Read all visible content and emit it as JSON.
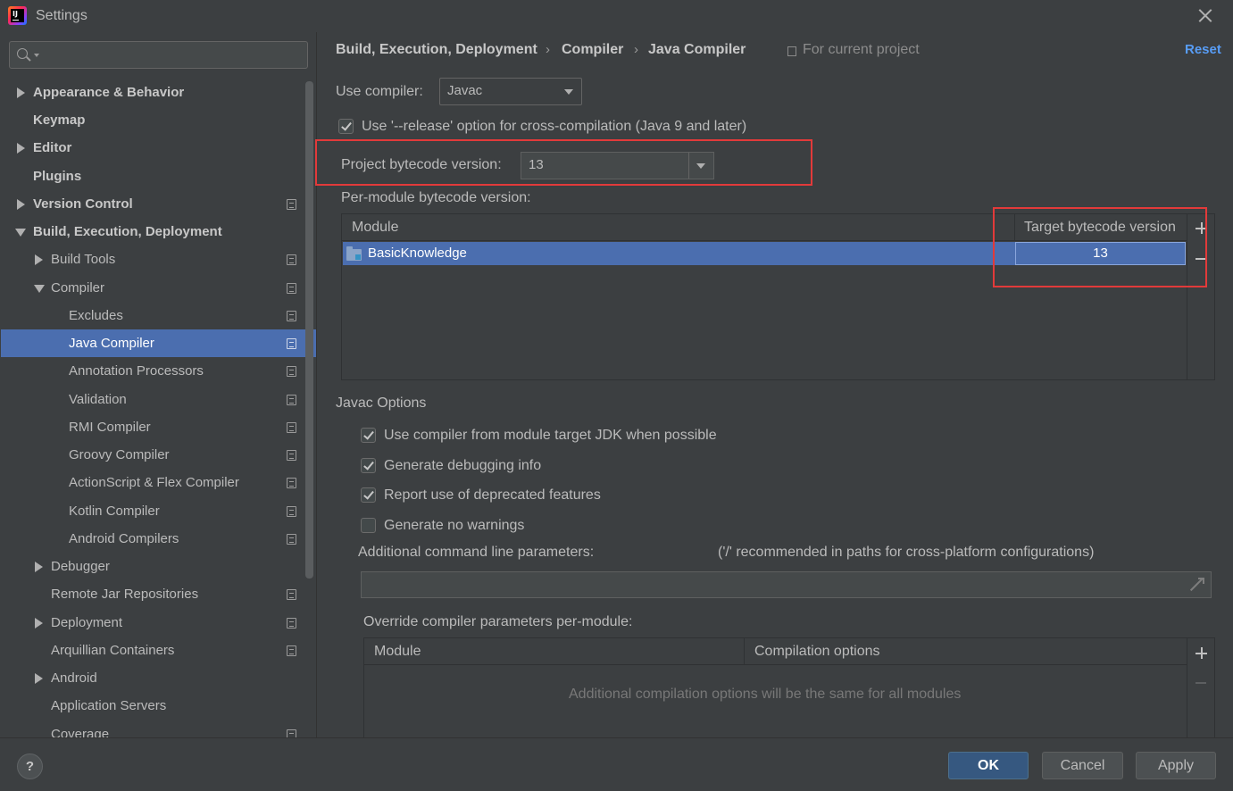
{
  "window": {
    "title": "Settings"
  },
  "search": {
    "placeholder": ""
  },
  "sidebar": {
    "items": [
      {
        "label": "Appearance & Behavior"
      },
      {
        "label": "Keymap"
      },
      {
        "label": "Editor"
      },
      {
        "label": "Plugins"
      },
      {
        "label": "Version Control"
      },
      {
        "label": "Build, Execution, Deployment"
      },
      {
        "label": "Build Tools"
      },
      {
        "label": "Compiler"
      },
      {
        "label": "Excludes"
      },
      {
        "label": "Java Compiler"
      },
      {
        "label": "Annotation Processors"
      },
      {
        "label": "Validation"
      },
      {
        "label": "RMI Compiler"
      },
      {
        "label": "Groovy Compiler"
      },
      {
        "label": "ActionScript & Flex Compiler"
      },
      {
        "label": "Kotlin Compiler"
      },
      {
        "label": "Android Compilers"
      },
      {
        "label": "Debugger"
      },
      {
        "label": "Remote Jar Repositories"
      },
      {
        "label": "Deployment"
      },
      {
        "label": "Arquillian Containers"
      },
      {
        "label": "Android"
      },
      {
        "label": "Application Servers"
      },
      {
        "label": "Coverage"
      }
    ]
  },
  "breadcrumb": {
    "items": [
      "Build, Execution, Deployment",
      "Compiler",
      "Java Compiler"
    ],
    "separator": "›",
    "scope": "For current project",
    "reset": "Reset"
  },
  "compiler": {
    "use_compiler_label": "Use compiler:",
    "use_compiler_value": "Javac",
    "release_option_label": "Use '--release' option for cross-compilation (Java 9 and later)",
    "release_option_checked": true,
    "project_bytecode_label": "Project bytecode version:",
    "project_bytecode_value": "13",
    "per_module_label": "Per-module bytecode version:",
    "module_table": {
      "headers": [
        "Module",
        "Target bytecode version"
      ],
      "rows": [
        {
          "module": "BasicKnowledge",
          "target": "13"
        }
      ]
    }
  },
  "javac": {
    "section_title": "Javac Options",
    "options": [
      {
        "label": "Use compiler from module target JDK when possible",
        "checked": true
      },
      {
        "label": "Generate debugging info",
        "checked": true
      },
      {
        "label": "Report use of deprecated features",
        "checked": true
      },
      {
        "label": "Generate no warnings",
        "checked": false
      }
    ],
    "additional_params_label": "Additional command line parameters:",
    "additional_params_hint": "('/' recommended in paths for cross-platform configurations)",
    "additional_params_value": "",
    "override_label": "Override compiler parameters per-module:",
    "override_table": {
      "headers": [
        "Module",
        "Compilation options"
      ],
      "empty_text": "Additional compilation options will be the same for all modules"
    }
  },
  "footer": {
    "help": "?",
    "ok": "OK",
    "cancel": "Cancel",
    "apply": "Apply"
  },
  "colors": {
    "background": "#3c3f41",
    "selection": "#4b6eaf",
    "link": "#589df6",
    "highlight_box": "#e23a3a",
    "primary_button": "#365880"
  }
}
